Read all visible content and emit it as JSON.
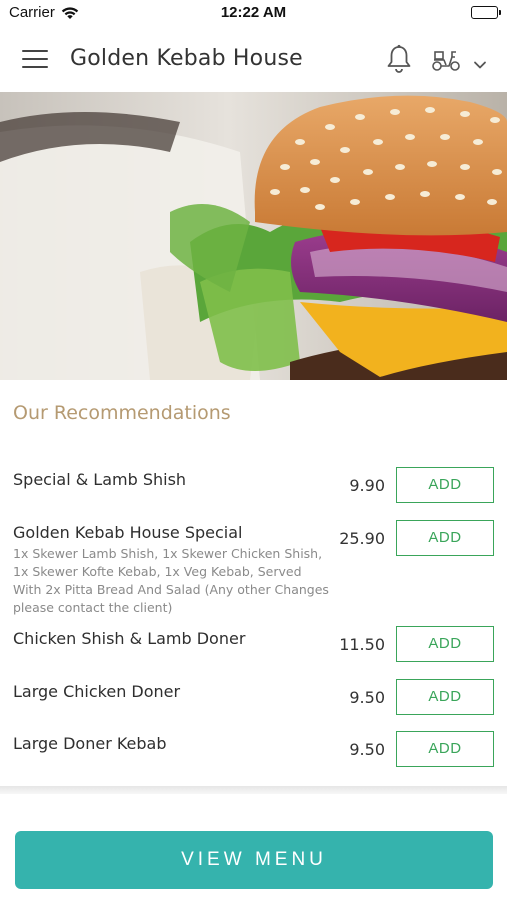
{
  "status_bar": {
    "carrier": "Carrier",
    "time": "12:22 AM"
  },
  "header": {
    "title": "Golden Kebab House",
    "icons": [
      "menu-icon",
      "bell-icon",
      "scooter-icon",
      "chevron-down-icon"
    ]
  },
  "recommendations": {
    "title": "Our Recommendations",
    "items": [
      {
        "name": "Special & Lamb Shish",
        "description": "",
        "price": "9.90",
        "button": "ADD"
      },
      {
        "name": "Golden Kebab House Special",
        "description": "1x Skewer Lamb Shish, 1x Skewer Chicken Shish, 1x Skewer Kofte Kebab, 1x Veg Kebab, Served With 2x Pitta Bread And Salad (Any other Changes please contact the client)",
        "price": "25.90",
        "button": "ADD"
      },
      {
        "name": "Chicken Shish & Lamb Doner",
        "description": "",
        "price": "11.50",
        "button": "ADD"
      },
      {
        "name": "Large Chicken Doner",
        "description": "",
        "price": "9.50",
        "button": "ADD"
      },
      {
        "name": "Large Doner Kebab",
        "description": "",
        "price": "9.50",
        "button": "ADD"
      }
    ]
  },
  "footer": {
    "view_menu_label": "VIEW MENU"
  },
  "colors": {
    "accent_gold": "#b59a72",
    "add_green": "#3aa55a",
    "teal": "#35b3ad"
  }
}
